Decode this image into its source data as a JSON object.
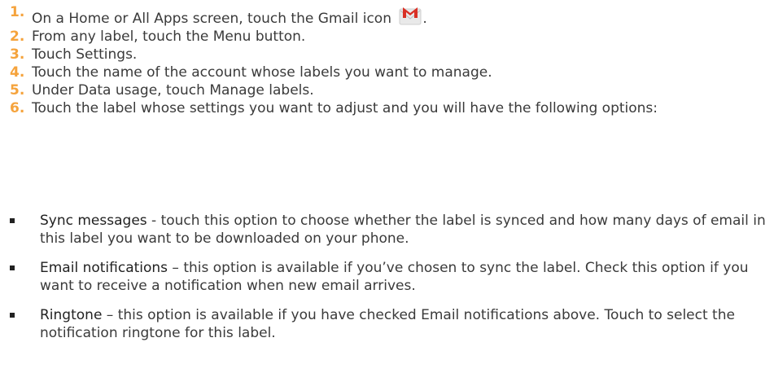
{
  "steps": [
    {
      "num": "1.",
      "text": "On a Home or All Apps screen, touch the Gmail icon",
      "suffix": "."
    },
    {
      "num": "2.",
      "text": "From any label, touch the Menu button."
    },
    {
      "num": "3.",
      "text": "Touch Settings."
    },
    {
      "num": "4.",
      "text": "Touch the name of the account whose labels you want to manage."
    },
    {
      "num": "5.",
      "text": "Under Data usage, touch Manage labels."
    },
    {
      "num": "6.",
      "text": "Touch the label whose settings you want to adjust and you will have the following options:"
    }
  ],
  "icons": {
    "gmail": "gmail-icon"
  },
  "colors": {
    "step_number": "#f5a33c",
    "body_text": "#3a3a3a",
    "gmail_red": "#d93025"
  },
  "bullets": [
    {
      "term": "Sync messages",
      "text": "  - touch this option to choose whether the label is synced and how many days of email in this label you want to be downloaded on your phone."
    },
    {
      "term": "Email notifications",
      "text": " – this option is available if you’ve chosen to sync the label. Check this option if you want to receive a notification when new email arrives."
    },
    {
      "term": "Ringtone",
      "text": " – this option is available if you have checked Email notifications above. Touch to select the notification ringtone for this label."
    }
  ]
}
